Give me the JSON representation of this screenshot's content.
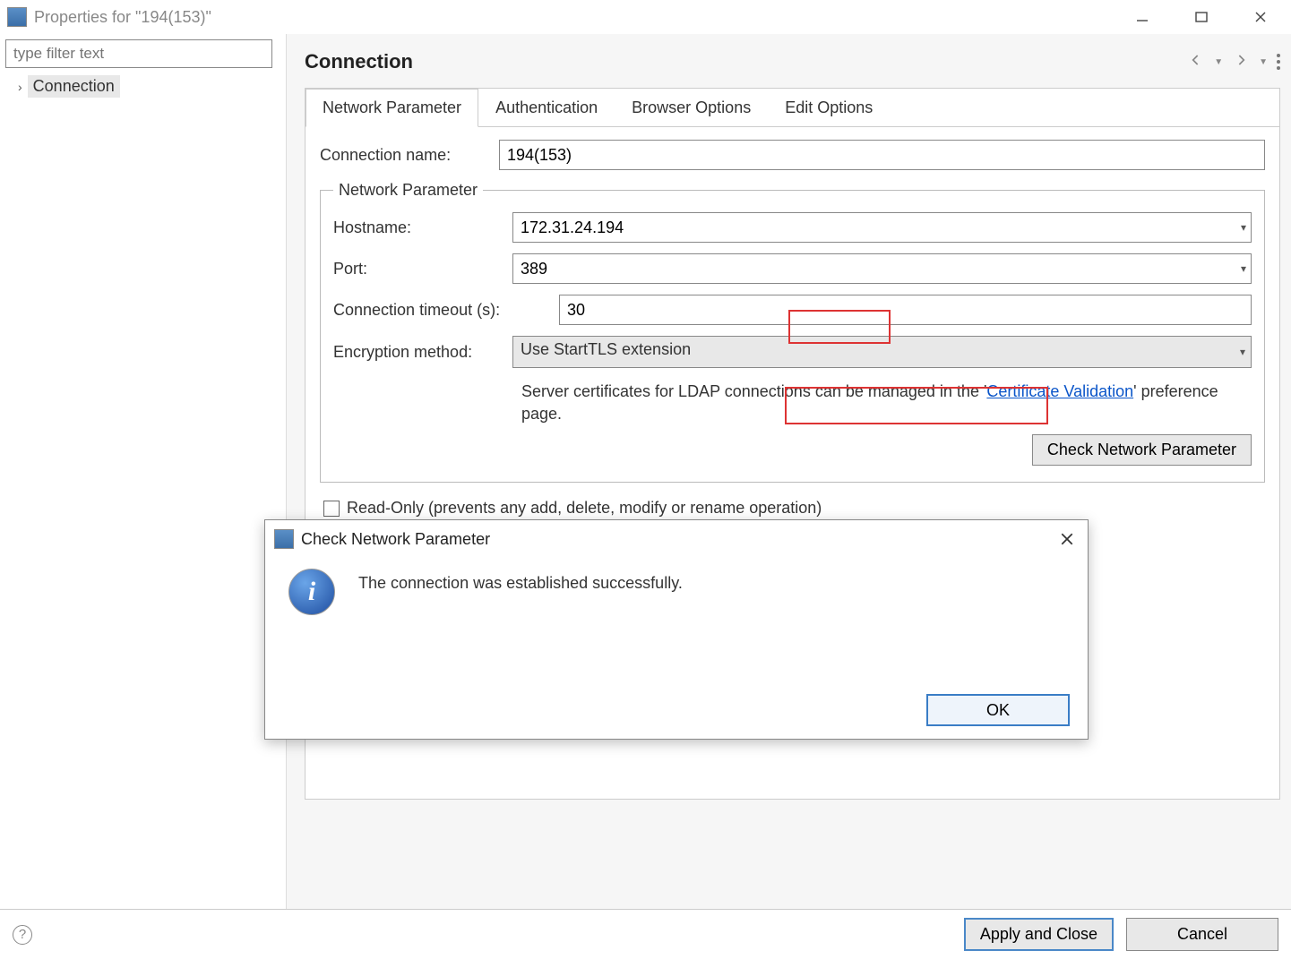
{
  "window": {
    "title": "Properties for \"194(153)\""
  },
  "sidebar": {
    "filter_placeholder": "type filter text",
    "tree_item": "Connection"
  },
  "header": {
    "title": "Connection"
  },
  "tabs": {
    "network": "Network Parameter",
    "auth": "Authentication",
    "browser": "Browser Options",
    "edit": "Edit Options"
  },
  "form": {
    "conn_name_label": "Connection name:",
    "conn_name_value": "194(153)",
    "group_legend": "Network Parameter",
    "hostname_label": "Hostname:",
    "hostname_value": "172.31.24.194",
    "port_label": "Port:",
    "port_value": "389",
    "timeout_label": "Connection timeout (s):",
    "timeout_value": "30",
    "encryption_label": "Encryption method:",
    "encryption_value": "Use StartTLS extension",
    "cert_text_pre": "Server certificates for LDAP connections can be managed in the '",
    "cert_link": "Certificate Validation",
    "cert_text_post": "' preference page.",
    "check_button": "Check Network Parameter",
    "readonly_label": "Read-Only (prevents any add, delete, modify or rename operation)"
  },
  "modal": {
    "title": "Check Network Parameter",
    "message": "The connection was established successfully.",
    "ok": "OK"
  },
  "footer": {
    "apply": "Apply and Close",
    "cancel": "Cancel"
  }
}
